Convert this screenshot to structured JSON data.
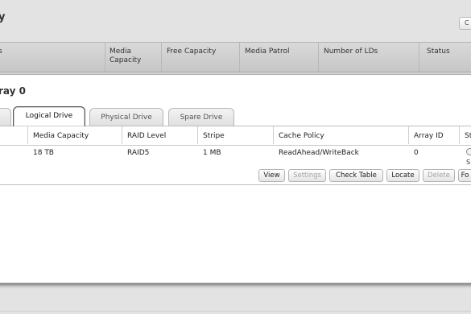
{
  "page": {
    "title_fragment": "y",
    "top_right_button": "C"
  },
  "header_bar": {
    "columns": [
      {
        "label": "s"
      },
      {
        "label": "Media Capacity"
      },
      {
        "label": "Free Capacity"
      },
      {
        "label": "Media Patrol"
      },
      {
        "label": "Number of LDs"
      },
      {
        "label": "Status"
      }
    ]
  },
  "panel": {
    "title": "ray 0",
    "tabs": [
      {
        "label": ""
      },
      {
        "label": "Logical Drive",
        "active": true
      },
      {
        "label": "Physical Drive"
      },
      {
        "label": "Spare Drive"
      }
    ],
    "table": {
      "headers": [
        "Media Capacity",
        "RAID Level",
        "Stripe",
        "Cache Policy",
        "Array ID",
        "St"
      ],
      "row": {
        "media_capacity": "18 TB",
        "raid_level": "RAID5",
        "stripe": "1 MB",
        "cache_policy": "ReadAhead/WriteBack",
        "array_id": "0",
        "status_text": "S"
      }
    },
    "buttons": [
      {
        "label": "View",
        "enabled": true
      },
      {
        "label": "Settings",
        "enabled": false
      },
      {
        "label": "Check Table",
        "enabled": true
      },
      {
        "label": "Locate",
        "enabled": true
      },
      {
        "label": "Delete",
        "enabled": false
      },
      {
        "label": "Fo",
        "enabled": true
      }
    ]
  }
}
